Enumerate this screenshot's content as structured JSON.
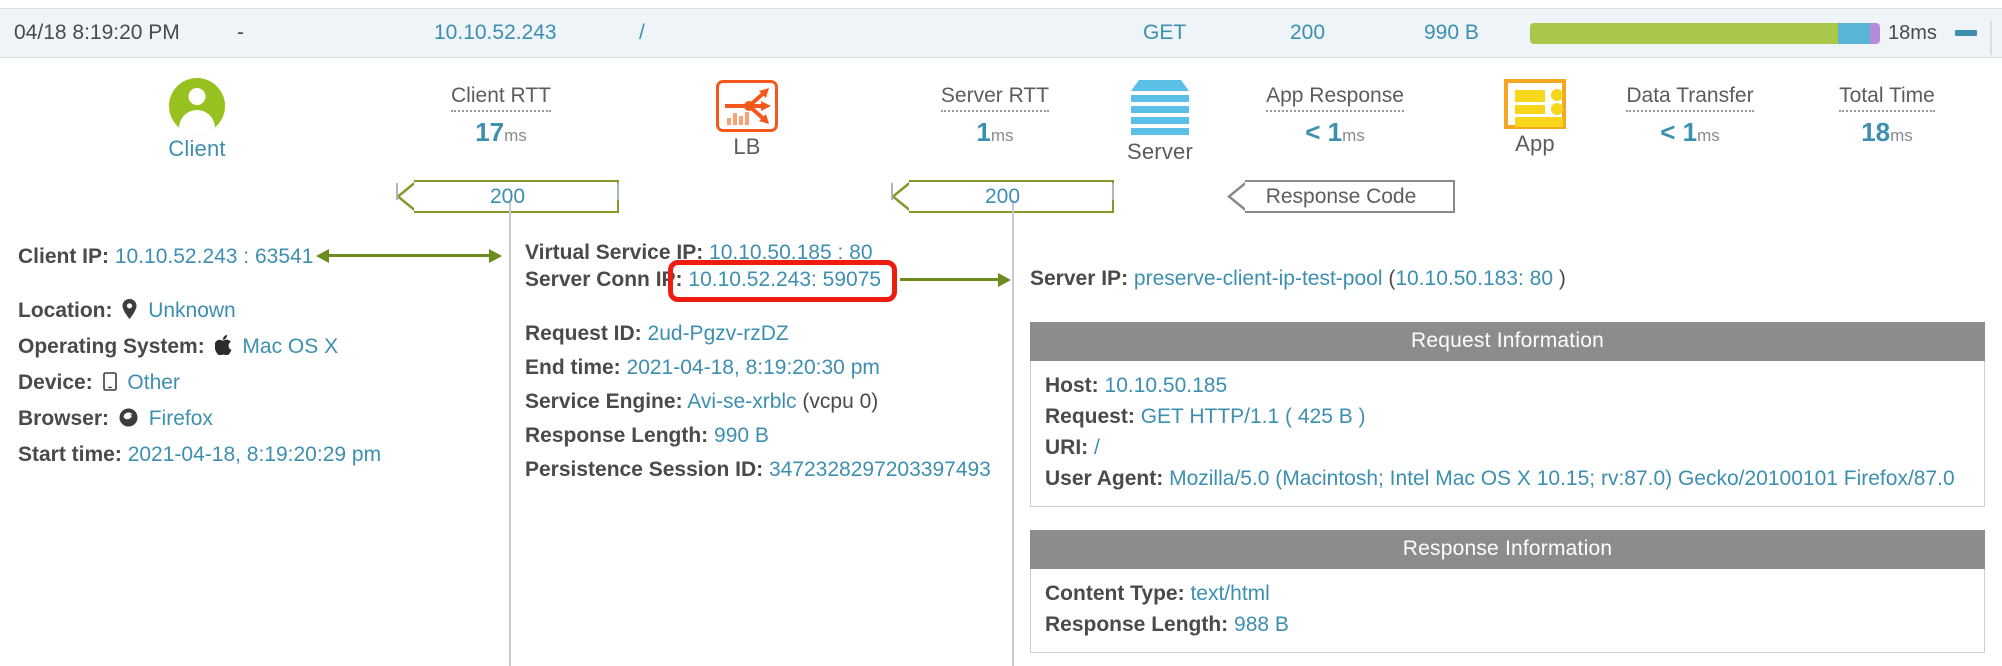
{
  "header": {
    "timestamp": "04/18 8:19:20 PM",
    "dash": "-",
    "client_ip": "10.10.52.243",
    "uri": "/",
    "method": "GET",
    "status": "200",
    "size": "990 B",
    "total_time": "18ms",
    "collapse_icon": "minus-icon",
    "progress": {
      "segments": [
        {
          "name": "green",
          "color": "#a9c84a",
          "pct": 88
        },
        {
          "name": "blue",
          "color": "#5ab4d4",
          "pct": 9
        },
        {
          "name": "purple",
          "color": "#b58ad6",
          "pct": 3
        }
      ]
    }
  },
  "timeline": {
    "nodes": [
      {
        "id": "client",
        "label": "Client",
        "icon": "user-avatar-icon"
      },
      {
        "id": "lb",
        "label": "LB",
        "icon": "load-balancer-icon"
      },
      {
        "id": "server",
        "label": "Server",
        "icon": "server-stack-icon"
      },
      {
        "id": "app",
        "label": "App",
        "icon": "application-icon"
      }
    ],
    "metrics": [
      {
        "id": "client-rtt",
        "title": "Client RTT",
        "prefix": "",
        "value": "17",
        "unit": "ms"
      },
      {
        "id": "server-rtt",
        "title": "Server RTT",
        "prefix": "",
        "value": "1",
        "unit": "ms"
      },
      {
        "id": "app-response",
        "title": "App Response",
        "prefix": "< ",
        "value": "1",
        "unit": "ms"
      },
      {
        "id": "data-transfer",
        "title": "Data Transfer",
        "prefix": "< ",
        "value": "1",
        "unit": "ms"
      },
      {
        "id": "total-time",
        "title": "Total Time",
        "prefix": "",
        "value": "18",
        "unit": "ms"
      }
    ],
    "flags": [
      {
        "id": "client-response-code",
        "text": "200",
        "style": "green"
      },
      {
        "id": "server-response-code",
        "text": "200",
        "style": "green"
      },
      {
        "id": "response-code-label",
        "text": "Response Code",
        "style": "gray"
      }
    ]
  },
  "client_column": {
    "client_ip_label": "Client IP:",
    "client_ip_value": "10.10.52.243 : 63541",
    "location_label": "Location:",
    "location_icon": "map-pin-icon",
    "location_value": "Unknown",
    "os_label": "Operating System:",
    "os_icon": "apple-icon",
    "os_value": "Mac OS X",
    "device_label": "Device:",
    "device_icon": "tablet-icon",
    "device_value": "Other",
    "browser_label": "Browser:",
    "browser_icon": "firefox-icon",
    "browser_value": "Firefox",
    "start_time_label": "Start time:",
    "start_time_value": "2021-04-18, 8:19:20:29 pm"
  },
  "lb_column": {
    "vs_ip_label": "Virtual Service IP:",
    "vs_ip_value": "10.10.50.185 : 80",
    "server_conn_label": "Server Conn IP:",
    "server_conn_value": "10.10.52.243: 59075",
    "request_id_label": "Request ID:",
    "request_id_value": "2ud-Pgzv-rzDZ",
    "end_time_label": "End time:",
    "end_time_value": "2021-04-18, 8:19:20:30 pm",
    "service_engine_label": "Service Engine:",
    "service_engine_value": "Avi-se-xrblc",
    "service_engine_suffix": "(vcpu 0)",
    "response_length_label": "Response Length:",
    "response_length_value": "990 B",
    "persistence_label": "Persistence Session ID:",
    "persistence_value": "3472328297203397493"
  },
  "server_column": {
    "server_ip_label": "Server IP:",
    "server_ip_pool": "preserve-client-ip-test-pool",
    "server_ip_detail_open": "(",
    "server_ip_detail": "10.10.50.183: 80",
    "server_ip_detail_close": " )",
    "request_panel": {
      "title": "Request Information",
      "rows": [
        {
          "label": "Host:",
          "value": "10.10.50.185"
        },
        {
          "label": "Request:",
          "value": "GET HTTP/1.1 ( 425 B )"
        },
        {
          "label": "URI:",
          "value": "/"
        },
        {
          "label": "User Agent:",
          "value": "Mozilla/5.0 (Macintosh; Intel Mac OS X 10.15; rv:87.0) Gecko/20100101 Firefox/87.0"
        }
      ]
    },
    "response_panel": {
      "title": "Response Information",
      "rows": [
        {
          "label": "Content Type:",
          "value": "text/html"
        },
        {
          "label": "Response Length:",
          "value": "988 B"
        }
      ]
    }
  },
  "annotation": {
    "highlight_name": "server-conn-ip-highlight",
    "color": "#ef1c10"
  }
}
